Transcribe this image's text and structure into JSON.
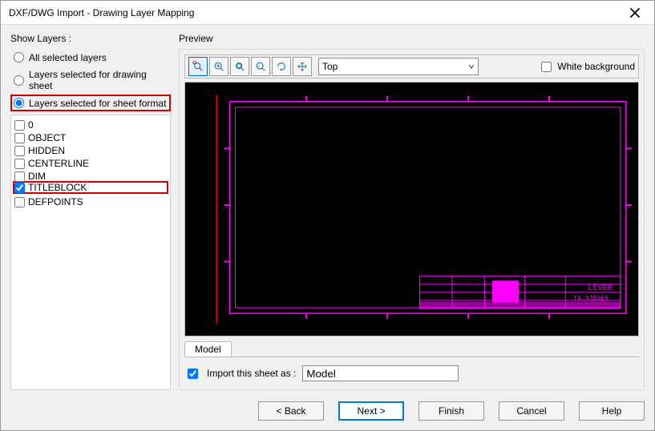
{
  "window": {
    "title": "DXF/DWG Import - Drawing Layer Mapping"
  },
  "show_layers": {
    "label": "Show Layers :",
    "options": [
      {
        "id": "all",
        "label": "All selected layers",
        "selected": false
      },
      {
        "id": "drawing",
        "label": "Layers selected for drawing sheet",
        "selected": false
      },
      {
        "id": "sheetformat",
        "label": "Layers selected for sheet format",
        "selected": true
      }
    ]
  },
  "layers": [
    {
      "name": "0",
      "checked": false
    },
    {
      "name": "OBJECT",
      "checked": false
    },
    {
      "name": "HIDDEN",
      "checked": false
    },
    {
      "name": "CENTERLINE",
      "checked": false
    },
    {
      "name": "DIM",
      "checked": false
    },
    {
      "name": "TITLEBLOCK",
      "checked": true
    },
    {
      "name": "DEFPOINTS",
      "checked": false
    }
  ],
  "preview": {
    "label": "Preview",
    "view_selected": "Top",
    "white_background_label": "White background",
    "white_background_checked": false,
    "titleblock_text1": "LEVER",
    "titleblock_text2": "TA-978969"
  },
  "tabs": {
    "model": "Model"
  },
  "import_as": {
    "label": "Import this sheet as :",
    "checked": true,
    "value": "Model"
  },
  "buttons": {
    "back": "< Back",
    "next": "Next >",
    "finish": "Finish",
    "cancel": "Cancel",
    "help": "Help"
  },
  "tool_icons": [
    "zoom-window",
    "zoom-in",
    "zoom-fit",
    "zoom-extents",
    "rotate",
    "pan"
  ]
}
